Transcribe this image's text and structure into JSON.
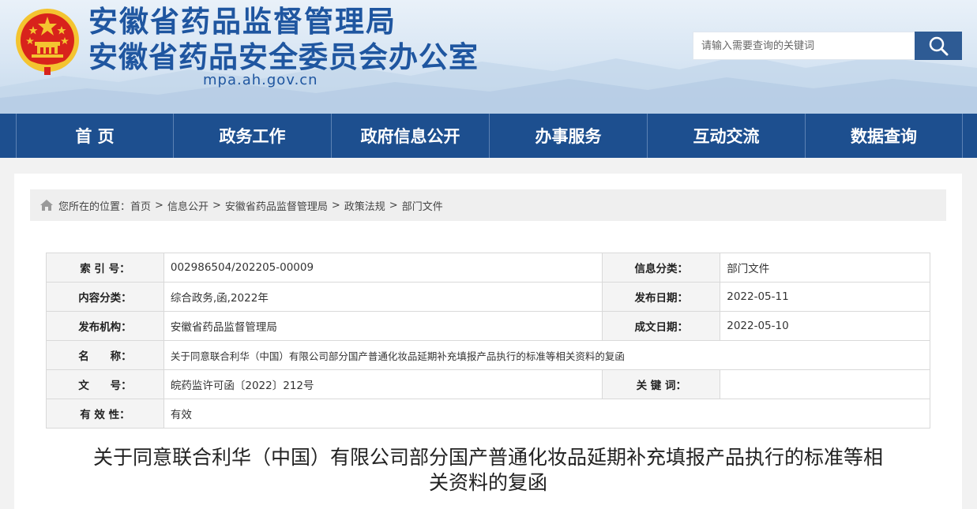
{
  "header": {
    "title_main": "安徽省药品监督管理局",
    "title_sub": "安徽省药品安全委员会办公室",
    "domain": "mpa.ah.gov.cn",
    "emblem_icon": "national-emblem-icon",
    "search": {
      "placeholder": "请输入需要查询的关键词",
      "value": "",
      "button_icon": "search-icon"
    }
  },
  "nav": {
    "items": [
      "首 页",
      "政务工作",
      "政府信息公开",
      "办事服务",
      "互动交流",
      "数据查询"
    ]
  },
  "breadcrumb": {
    "home_icon": "home-icon",
    "prefix": "您所在的位置：",
    "items": [
      "首页",
      "信息公开",
      "安徽省药品监督管理局",
      "政策法规",
      "部门文件"
    ],
    "separator": ">"
  },
  "meta": {
    "index_no_label": "索 引 号：",
    "index_no": "002986504/202205-00009",
    "info_cat_label": "信息分类：",
    "info_cat": "部门文件",
    "content_cat_label": "内容分类：",
    "content_cat": "综合政务,函,2022年",
    "pub_date_label": "发布日期：",
    "pub_date": "2022-05-11",
    "issuer_label": "发布机构：",
    "issuer": "安徽省药品监督管理局",
    "made_date_label": "成文日期：",
    "made_date": "2022-05-10",
    "name_label": "名　　称：",
    "name": "关于同意联合利华（中国）有限公司部分国产普通化妆品延期补充填报产品执行的标准等相关资料的复函",
    "doc_no_label": "文　　号：",
    "doc_no": "皖药监许可函〔2022〕212号",
    "keywords_label": "关 键 词：",
    "keywords": "",
    "validity_label": "有 效 性：",
    "validity": "有效"
  },
  "document": {
    "title_line1": "关于同意联合利华（中国）有限公司部分国产普通化妆品延期补充填报产品执行的标准等相",
    "title_line2": "关资料的复函"
  },
  "colors": {
    "brand_blue": "#1f56a0",
    "nav_bg": "#1d4f8f",
    "search_btn": "#2e5b94",
    "emblem_red": "#d8231c",
    "emblem_gold": "#f4c430"
  }
}
